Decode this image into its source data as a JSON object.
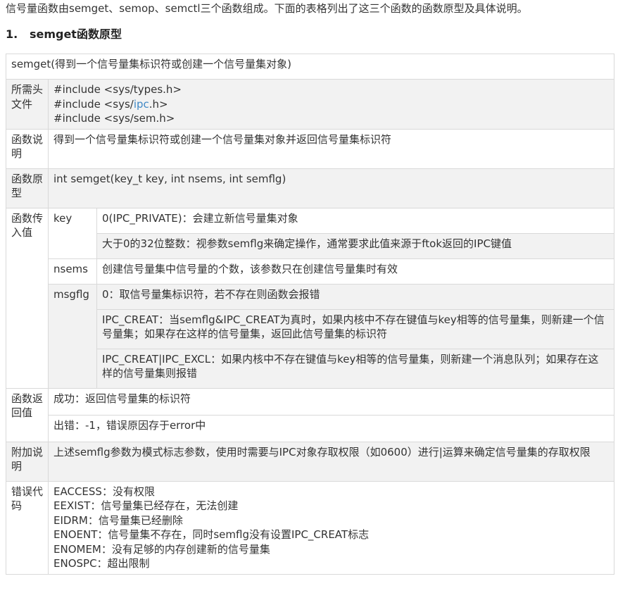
{
  "intro": "信号量函数由semget、semop、semctl三个函数组成。下面的表格列出了这三个函数的函数原型及具体说明。",
  "section": {
    "number": "1.",
    "title": "semget函数原型"
  },
  "table": {
    "header": "semget(得到一个信号量集标识符或创建一个信号量集对象)",
    "headers_label": "所需头文件",
    "headers_lines": [
      {
        "before": "#include <sys/types.h>",
        "link": "",
        "after": ""
      },
      {
        "before": "#include <sys/",
        "link": "ipc",
        "after": ".h>"
      },
      {
        "before": "#include <sys/sem.h>",
        "link": "",
        "after": ""
      }
    ],
    "desc_label": "函数说明",
    "desc_text": "得到一个信号量集标识符或创建一个信号量集对象并返回信号量集标识符",
    "proto_label": "函数原型",
    "proto_text": "int semget(key_t key, int nsems, int semflg)",
    "params_label": "函数传入值",
    "params": {
      "key_name": "key",
      "key_values": [
        "0(IPC_PRIVATE)：会建立新信号量集对象",
        "大于0的32位整数：视参数semflg来确定操作，通常要求此值来源于ftok返回的IPC键值"
      ],
      "nsems_name": "nsems",
      "nsems_values": [
        "创建信号量集中信号量的个数，该参数只在创建信号量集时有效"
      ],
      "msgflg_name": "msgflg",
      "msgflg_values": [
        "0：取信号量集标识符，若不存在则函数会报错",
        "IPC_CREAT：当semflg&IPC_CREAT为真时，如果内核中不存在键值与key相等的信号量集，则新建一个信号量集；如果存在这样的信号量集，返回此信号量集的标识符",
        "IPC_CREAT|IPC_EXCL：如果内核中不存在键值与key相等的信号量集，则新建一个消息队列；如果存在这样的信号量集则报错"
      ]
    },
    "return_label": "函数返回值",
    "return_values": [
      "成功：返回信号量集的标识符",
      "出错：-1，错误原因存于error中"
    ],
    "extra_label": "附加说明",
    "extra_text": "上述semflg参数为模式标志参数，使用时需要与IPC对象存取权限（如0600）进行|运算来确定信号量集的存取权限",
    "errors_label": "错误代码",
    "errors": [
      "EACCESS：没有权限",
      "EEXIST：信号量集已经存在，无法创建",
      "EIDRM：信号量集已经删除",
      "ENOENT：信号量集不存在，同时semflg没有设置IPC_CREAT标志",
      "ENOMEM：没有足够的内存创建新的信号量集",
      "ENOSPC：超出限制"
    ]
  }
}
